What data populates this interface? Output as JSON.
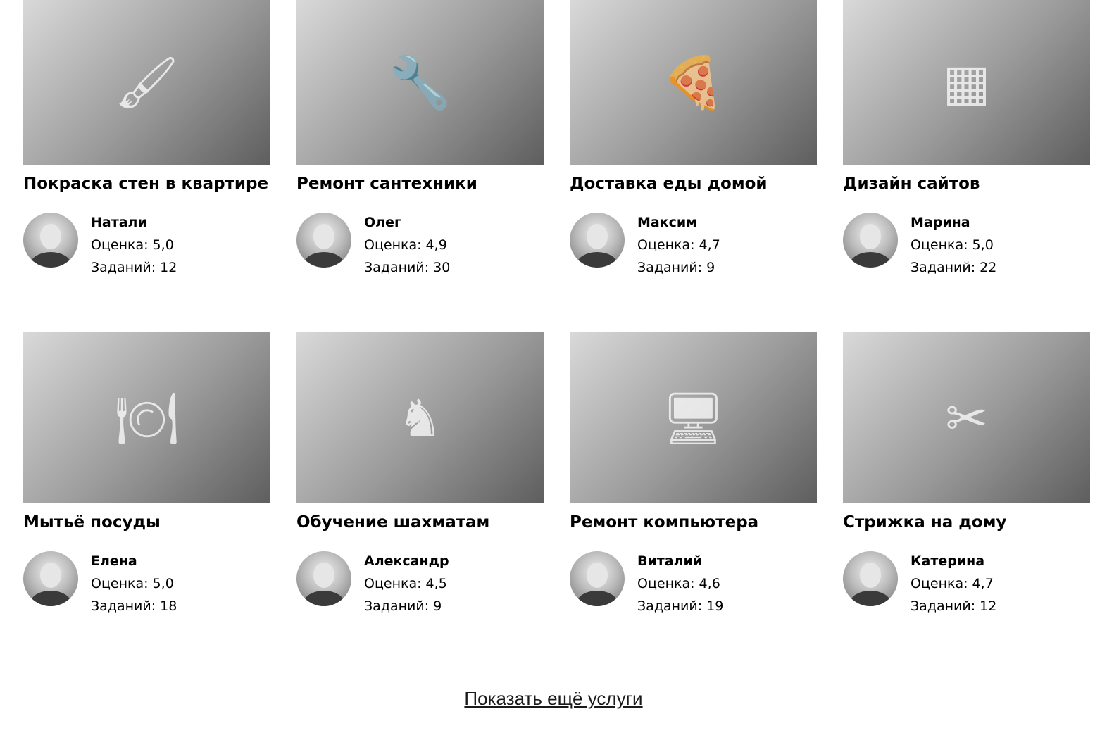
{
  "services": [
    {
      "title": "Покраска стен в квартире",
      "icon": "paint-roller-icon",
      "glyph": "🖌",
      "person": {
        "name": "Натали",
        "rating": "Оценка: 5,0",
        "tasks": "Заданий: 12"
      }
    },
    {
      "title": "Ремонт сантехники",
      "icon": "faucet-icon",
      "glyph": "🔧",
      "person": {
        "name": "Олег",
        "rating": "Оценка: 4,9",
        "tasks": "Заданий: 30"
      }
    },
    {
      "title": "Доставка еды домой",
      "icon": "pizza-icon",
      "glyph": "🍕",
      "person": {
        "name": "Максим",
        "rating": "Оценка: 4,7",
        "tasks": "Заданий: 9"
      }
    },
    {
      "title": "Дизайн сайтов",
      "icon": "wireframe-icon",
      "glyph": "▦",
      "person": {
        "name": "Марина",
        "rating": "Оценка: 5,0",
        "tasks": "Заданий: 22"
      }
    },
    {
      "title": "Мытьё посуды",
      "icon": "dishes-icon",
      "glyph": "🍽",
      "person": {
        "name": "Елена",
        "rating": "Оценка: 5,0",
        "tasks": "Заданий: 18"
      }
    },
    {
      "title": "Обучение шахматам",
      "icon": "chessboard-icon",
      "glyph": "♞",
      "person": {
        "name": "Александр",
        "rating": "Оценка: 4,5",
        "tasks": "Заданий: 9"
      }
    },
    {
      "title": "Ремонт компьютера",
      "icon": "computer-icon",
      "glyph": "🖥",
      "person": {
        "name": "Виталий",
        "rating": "Оценка: 4,6",
        "tasks": "Заданий: 19"
      }
    },
    {
      "title": "Стрижка на дому",
      "icon": "scissors-icon",
      "glyph": "✂",
      "person": {
        "name": "Катерина",
        "rating": "Оценка: 4,7",
        "tasks": "Заданий: 12"
      }
    }
  ],
  "show_more_label": "Показать ещё услуги"
}
